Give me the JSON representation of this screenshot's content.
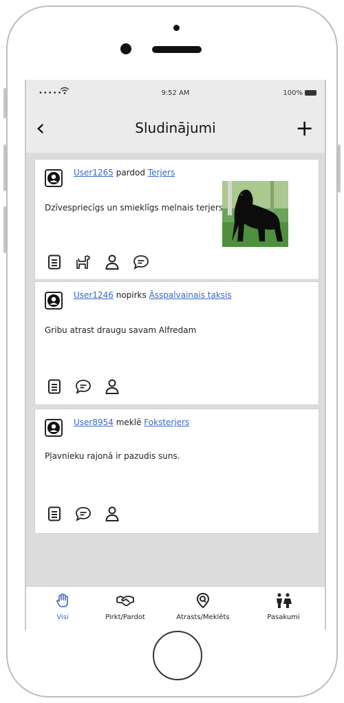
{
  "status_bar": {
    "signal": "•••••",
    "time": "9:52 AM",
    "battery": "100%"
  },
  "nav": {
    "back_icon": "‹",
    "title": "Sludinājumi",
    "add_icon": "+"
  },
  "posts": [
    {
      "user": "User1265",
      "action": "pardod",
      "item": "Terjers",
      "text": "Dzīvespriecīgs un smieklīgs melnais terjers"
    },
    {
      "user": "User1246",
      "action": "nopirks",
      "item": "Āsspalvainais taksis",
      "text": "Gribu atrast draugu savam Alfredam"
    },
    {
      "user": "User8954",
      "action": "meklē",
      "item": "Foksterjers",
      "text": "Pļavnieku rajonā ir pazudis suns."
    }
  ],
  "tabs": [
    {
      "label": "Visi",
      "icon": "hand-icon",
      "active": true
    },
    {
      "label": "Pirkt/Pardot",
      "icon": "handshake-icon"
    },
    {
      "label": "Atrasts/Meklēts",
      "icon": "search-pin-icon"
    },
    {
      "label": "Pasakumi",
      "icon": "people-icon"
    }
  ],
  "colors": {
    "accent": "#3a66c4",
    "screen_bg": "#dcdcdc",
    "bar_bg": "#ebebeb"
  }
}
